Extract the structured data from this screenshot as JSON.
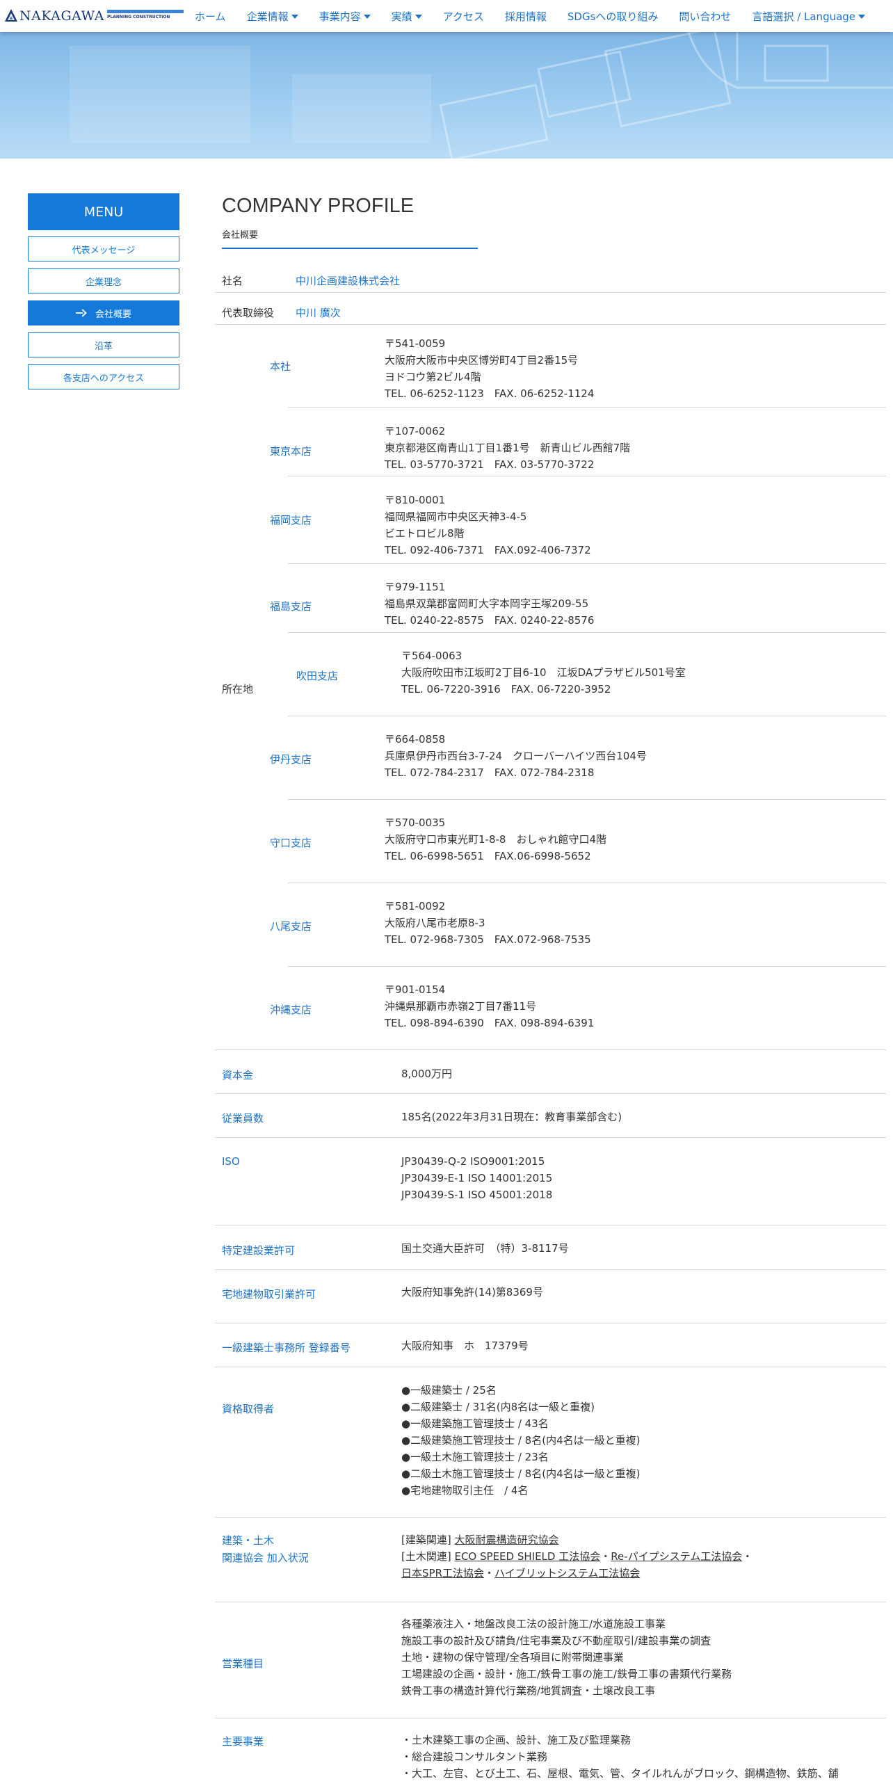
{
  "nav": {
    "logo_text": "NAKAGAWA",
    "logo_sub": "PLANNING CONSTRUCTION",
    "items": [
      {
        "label": "ホーム",
        "dropdown": false
      },
      {
        "label": "企業情報",
        "dropdown": true
      },
      {
        "label": "事業内容",
        "dropdown": true
      },
      {
        "label": "実績",
        "dropdown": true
      },
      {
        "label": "アクセス",
        "dropdown": false
      },
      {
        "label": "採用情報",
        "dropdown": false
      },
      {
        "label": "SDGsへの取り組み",
        "dropdown": false
      },
      {
        "label": "問い合わせ",
        "dropdown": false
      },
      {
        "label": "言語選択 / Language",
        "dropdown": true
      }
    ]
  },
  "sidebar": {
    "menu_label": "MENU",
    "items": [
      {
        "label": "代表メッセージ",
        "active": false
      },
      {
        "label": "企業理念",
        "active": false
      },
      {
        "label": "会社概要",
        "active": true
      },
      {
        "label": "沿革",
        "active": false
      },
      {
        "label": "各支店へのアクセス",
        "active": false
      }
    ]
  },
  "page": {
    "title": "COMPANY PROFILE",
    "subtitle": "会社概要"
  },
  "profile": {
    "company_label": "社名",
    "company_value": "中川企画建設株式会社",
    "ceo_label": "代表取締役",
    "ceo_value": "中川 廣次",
    "location_label": "所在地",
    "offices": [
      {
        "name": "本社",
        "lines": [
          "〒541-0059",
          "大阪府大阪市中央区博労町4丁目2番15号",
          "ヨドコウ第2ビル4階",
          "TEL. 06-6252-1123　FAX. 06-6252-1124"
        ]
      },
      {
        "name": "東京本店",
        "lines": [
          "〒107-0062",
          "東京都港区南青山1丁目1番1号　新青山ビル西館7階",
          "TEL. 03-5770-3721　FAX. 03-5770-3722"
        ]
      },
      {
        "name": "福岡支店",
        "lines": [
          "〒810-0001",
          "福岡県福岡市中央区天神3-4-5",
          "ビエトロビル8階",
          "TEL. 092-406-7371　FAX.092-406-7372"
        ]
      },
      {
        "name": "福島支店",
        "lines": [
          "〒979-1151",
          "福島県双葉郡富岡町大字本岡字王塚209-55",
          "TEL. 0240-22-8575　FAX. 0240-22-8576"
        ]
      },
      {
        "name": "吹田支店",
        "lines": [
          "〒564-0063",
          "大阪府吹田市江坂町2丁目6-10　江坂DAプラザビル501号室",
          "TEL. 06-7220-3916　FAX. 06-7220-3952"
        ]
      },
      {
        "name": "伊丹支店",
        "lines": [
          "〒664-0858",
          "兵庫県伊丹市西台3-7-24　クローバーハイツ西台104号",
          "TEL. 072-784-2317　FAX. 072-784-2318"
        ]
      },
      {
        "name": "守口支店",
        "lines": [
          "〒570-0035",
          "大阪府守口市東光町1-8-8　おしゃれ館守口4階",
          "TEL. 06-6998-5651　FAX.06-6998-5652"
        ]
      },
      {
        "name": "八尾支店",
        "lines": [
          "〒581-0092",
          "大阪府八尾市老原8-3",
          "TEL. 072-968-7305　FAX.072-968-7535"
        ]
      },
      {
        "name": "沖縄支店",
        "lines": [
          "〒901-0154",
          "沖縄県那覇市赤嶺2丁目7番11号",
          "TEL. 098-894-6390　FAX. 098-894-6391"
        ]
      }
    ],
    "capital_label": "資本金",
    "capital_value": "8,000万円",
    "employees_label": "従業員数",
    "employees_value": "185名(2022年3月31日現在：教育事業部含む)",
    "iso_label": "ISO",
    "iso_lines": [
      "JP30439-Q-2 ISO9001:2015",
      "JP30439-E-1 ISO 14001:2015",
      "JP30439-S-1 ISO 45001:2018"
    ],
    "license_label": "特定建設業許可",
    "license_value": "国土交通大臣許可　（特）3-8117号",
    "realestate_label": "宅地建物取引業許可",
    "realestate_value": "大阪府知事免許(14)第8369号",
    "architect_label": "一級建築士事務所 登録番号",
    "architect_value": "大阪府知事　ホ　17379号",
    "qual_label": "資格取得者",
    "qual_lines": [
      "●一級建築士 / 25名",
      "●二級建築士 / 31名(内8名は一級と重複)",
      "●一級建築施工管理技士 / 43名",
      "●二級建築施工管理技士 / 8名(内4名は一級と重複)",
      "●一級土木施工管理技士 / 23名",
      "●二級土木施工管理技士 / 8名(内4名は一級と重複)",
      "●宅地建物取引主任　/ 4名"
    ],
    "assoc_label_1": "建築・土木",
    "assoc_label_2": "関連協会 加入状況",
    "assoc": {
      "prefix1": "[建築関連] ",
      "link1": "大阪耐震構造研究協会",
      "prefix2": "[土木関連] ",
      "link2": "ECO SPEED SHIELD 工法協会",
      "sep": "・",
      "link3": "Re-パイプシステム工法協会",
      "sep2": "・",
      "link4": "日本SPR工法協会",
      "sep3": "・",
      "link5": "ハイブリットシステム工法協会"
    },
    "business_label": "営業種目",
    "business_lines": [
      "各種薬液注入・地盤改良工法の設計施工/水道施設工事業",
      "施設工事の設計及び請負/住宅事業及び不動産取引/建設事業の調査",
      "土地・建物の保守管理/全各項目に附帯関連事業",
      "工場建設の企画・設計・施工/鉄骨工事の施工/鉄骨工事の書類代行業務",
      "鉄骨工事の構造計算代行業務/地質調査・土壌改良工事"
    ],
    "main_label": "主要事業",
    "main_lines": [
      "・土木建築工事の企画、設計、施工及び監理業務",
      "・総合建設コンサルタント業務",
      "・大工、左官、とび土工、石、屋根、電気、管、タイルれんがブロック、鋼構造物、鉄筋、舗"
    ]
  }
}
